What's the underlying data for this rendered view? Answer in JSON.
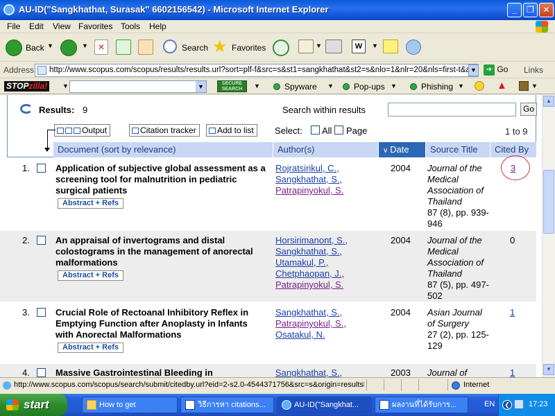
{
  "window": {
    "title": "AU-ID(\"Sangkhathat, Surasak\" 6602156542) - Microsoft Internet Explorer",
    "min": "_",
    "max": "❐",
    "close": "✕"
  },
  "menu": [
    "File",
    "Edit",
    "View",
    "Favorites",
    "Tools",
    "Help"
  ],
  "toolbar": {
    "back": "Back",
    "search": "Search",
    "favorites": "Favorites"
  },
  "address": {
    "label": "Address",
    "url": "http://www.scopus.com/scopus/results/results.url?sort=plf-f&src=s&st1=sangkhathat&st2=s&nlo=1&nlr=20&nls=first-t&aff",
    "go": "Go",
    "links": "Links"
  },
  "stopzilla": {
    "logo_a": "STOP",
    "logo_b": "zilla!",
    "secure": "SECURE SEARCH",
    "spyware": "Spyware",
    "popups": "Pop-ups",
    "phishing": "Phishing"
  },
  "results": {
    "label": "Results:",
    "count": "9",
    "within_label": "Search within results",
    "within_value": "",
    "go": "Go",
    "output": "Output",
    "citation_tracker": "Citation tracker",
    "add_to_list": "Add to list",
    "select": "Select:",
    "all": "All",
    "page": "Page",
    "range": "1 to 9"
  },
  "columns": {
    "document": "Document (sort by relevance)",
    "authors": "Author(s)",
    "date": "Date",
    "source": "Source Title",
    "cited": "Cited By"
  },
  "abstract_label": "Abstract + Refs",
  "rows": [
    {
      "num": "1.",
      "title": "Application of subjective global assessment as a screening tool for malnutrition in pediatric surgical patients",
      "authors": [
        "Rojratsirikul, C.,",
        "Sangkhathat, S.,",
        "Patrapinyokul, S."
      ],
      "date": "2004",
      "source": "Journal of the Medical Association of Thailand",
      "volume": "87 (8), pp. 939-946",
      "cited": "3"
    },
    {
      "num": "2.",
      "title": "An appraisal of invertograms and distal colostograms in the management of anorectal malformations",
      "authors": [
        "Horsirimanont, S.,",
        "Sangkhathat, S.,",
        "Utamakul, P.,",
        "Chetphaopan, J.,",
        "Patrapinyokul, S."
      ],
      "date": "2004",
      "source": "Journal of the Medical Association of Thailand",
      "volume": "87 (5), pp. 497-502",
      "cited": "0"
    },
    {
      "num": "3.",
      "title": "Crucial Role of Rectoanal Inhibitory Reflex in Emptying Function after Anoplasty in Infants with Anorectal Malformations",
      "authors": [
        "Sangkhathat, S.,",
        "Patrapinyokul, S.,",
        "Osatakul, N."
      ],
      "date": "2004",
      "source": "Asian Journal of Surgery",
      "volume": "27 (2), pp. 125-129",
      "cited": "1"
    },
    {
      "num": "4.",
      "title": "Massive Gastrointestinal Bleeding in",
      "authors": [
        "Sangkhathat, S.,"
      ],
      "date": "2003",
      "source": "Journal of",
      "volume": "",
      "cited": "1"
    }
  ],
  "status": {
    "text": "http://www.scopus.com/scopus/search/submit/citedby.url?eid=2-s2.0-4544371756&src=s&origin=resultslist",
    "zone": "Internet"
  },
  "taskbar": {
    "start": "start",
    "tasks": [
      "How to get",
      "วิธีการหา citations...",
      "AU-ID(\"Sangkhat...",
      "ผลงานที่ได้รับการ..."
    ],
    "lang": "EN",
    "clock": "17:23"
  }
}
